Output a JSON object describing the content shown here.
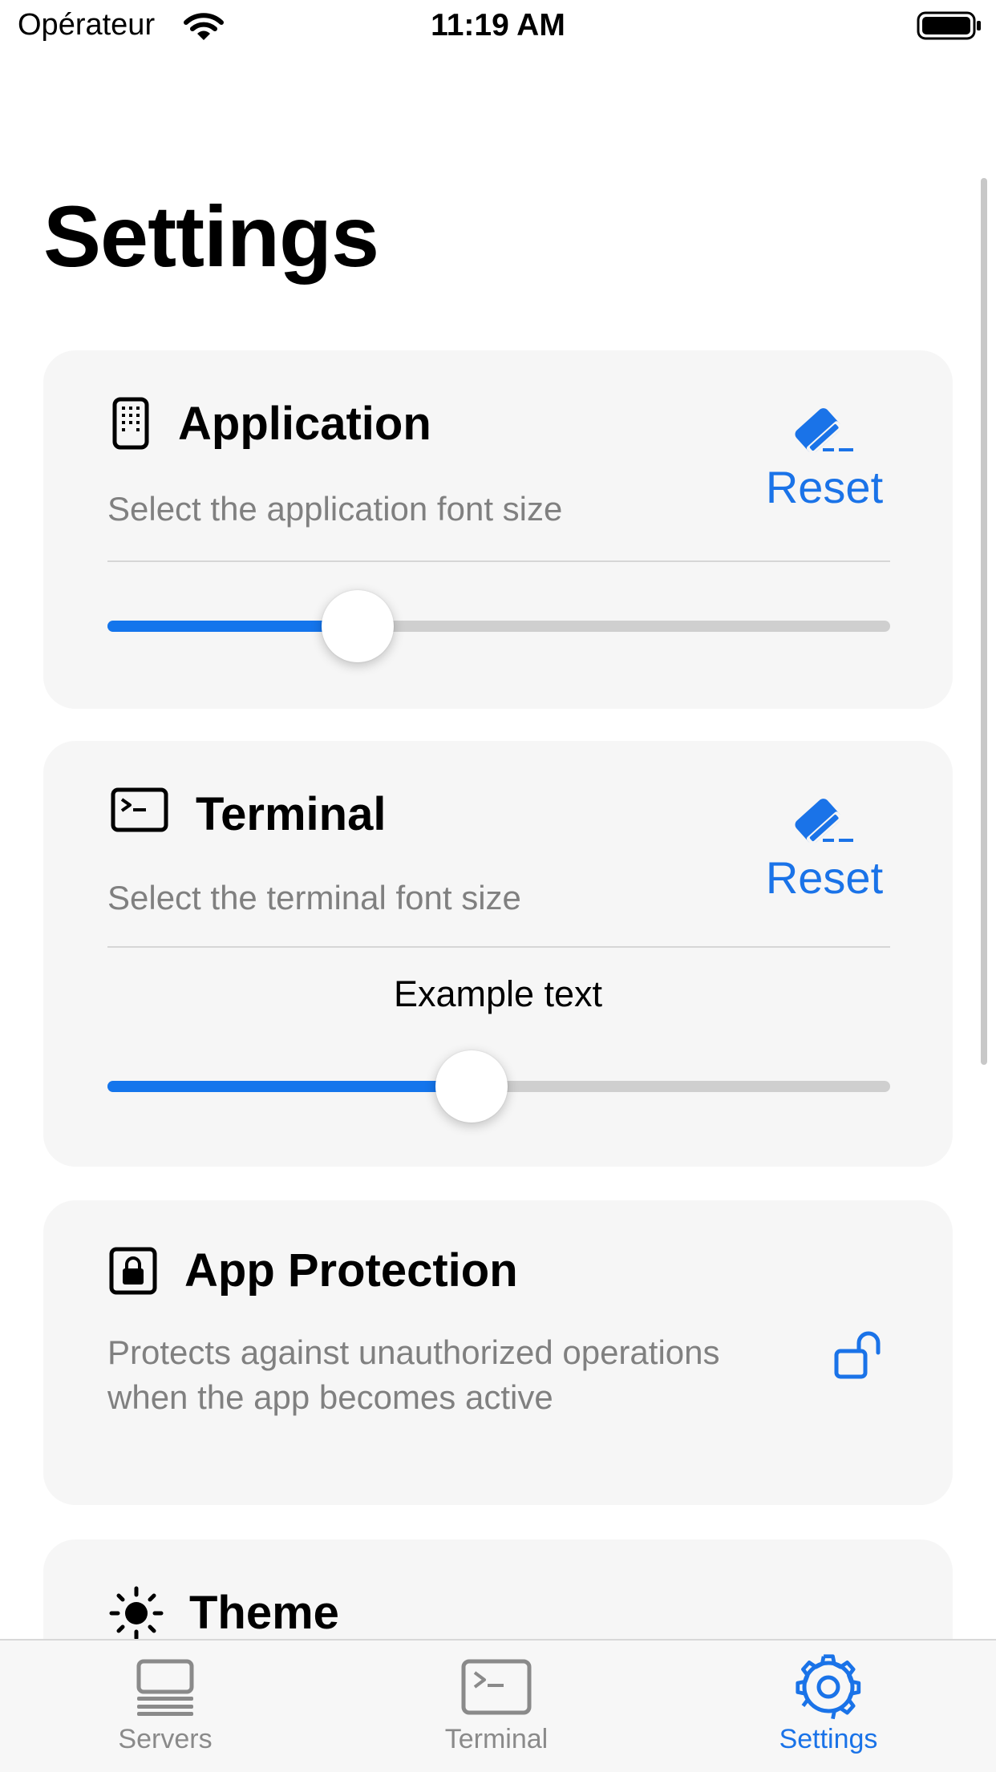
{
  "status_bar": {
    "carrier": "Opérateur",
    "time": "11:19 AM"
  },
  "page": {
    "title": "Settings"
  },
  "cards": {
    "application": {
      "title": "Application",
      "icon": "phone-icon",
      "description": "Select the application font size",
      "reset_label": "Reset",
      "slider_value": 0.32
    },
    "terminal": {
      "title": "Terminal",
      "icon": "terminal-icon",
      "description": "Select the terminal font size",
      "reset_label": "Reset",
      "example_text": "Example text",
      "slider_value": 0.465
    },
    "app_protection": {
      "title": "App Protection",
      "icon": "lock-icon",
      "description": "Protects against unauthorized operations when the app becomes active",
      "toggle_icon": "unlock-icon"
    },
    "theme": {
      "title": "Theme",
      "icon": "sun-icon"
    }
  },
  "tab_bar": {
    "tabs": [
      {
        "label": "Servers",
        "icon": "servers-icon",
        "active": false
      },
      {
        "label": "Terminal",
        "icon": "terminal-icon",
        "active": false
      },
      {
        "label": "Settings",
        "icon": "gear-icon",
        "active": true
      }
    ]
  },
  "colors": {
    "accent": "#1a73e8",
    "card_background": "#f6f6f6",
    "secondary_text": "#808080",
    "inactive_tab": "#8a8a8a"
  }
}
